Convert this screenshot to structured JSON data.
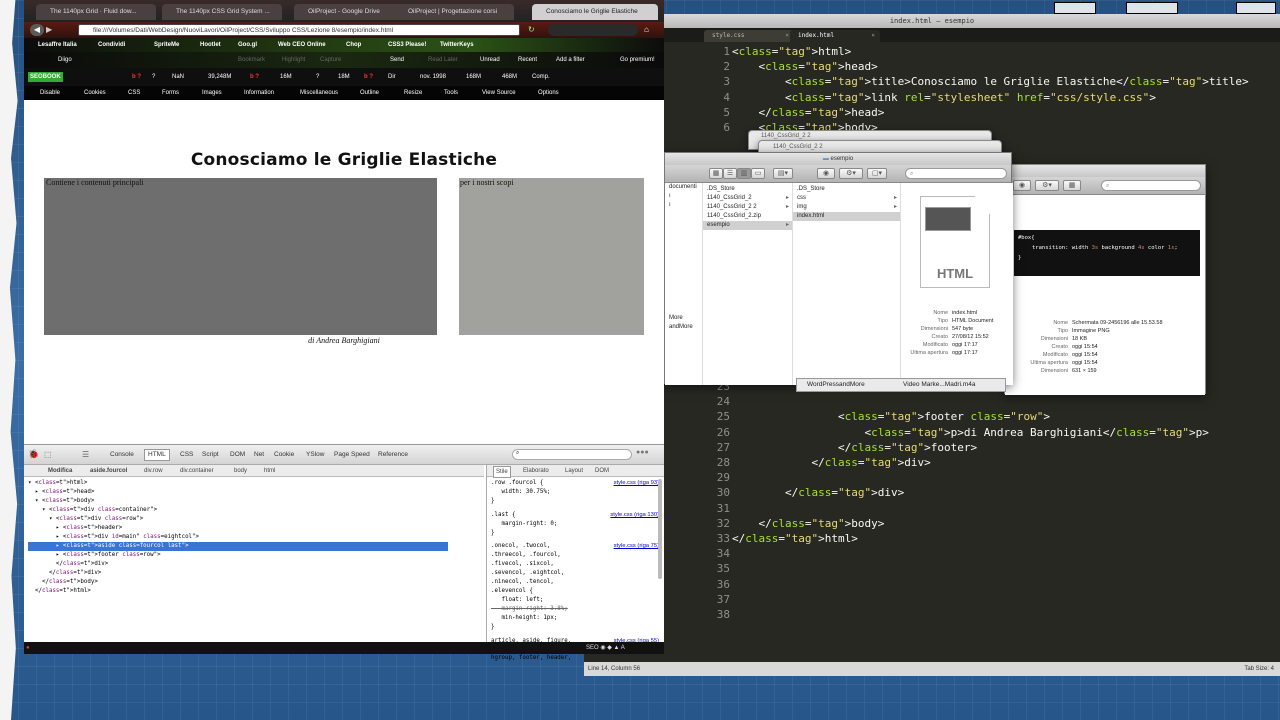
{
  "firefox": {
    "tabs": [
      "The 1140px Grid · Fluid dow...",
      "The 1140px CSS Grid System ...",
      "OilProject - Google Drive",
      "OilProject | Progettazione corsi",
      "Conosciamo le Griglie Elastiche"
    ],
    "url": "file:///Volumes/Dati/WebDesign/NuoviLavori/OilProject/CSS/Sviluppo CSS/Lezione 8/esempio/index.html",
    "bookmarks": [
      "Lesaffre Italia",
      "Condividi",
      "SpriteMe",
      "Hootlet",
      "Goo.gl",
      "Web CEO Online",
      "Chop",
      "CSS3 Please!",
      "TwitterKeys"
    ],
    "toolbar2": [
      "Diigo",
      "Bookmark",
      "Highlight",
      "Capture",
      "Send",
      "Read Later",
      "Unread",
      "Recent",
      "Add a filter",
      "Go premium!"
    ],
    "seobar": [
      "SEOBOOK",
      "b ?",
      "?",
      "NaN",
      "39,248M",
      "b ?",
      "16M",
      "?",
      "18M",
      "b ?",
      "Dir",
      "nov. 1998",
      "168M",
      "468M",
      "Comp."
    ],
    "webdev": [
      "Disable",
      "Cookies",
      "CSS",
      "Forms",
      "Images",
      "Information",
      "Miscellaneous",
      "Outline",
      "Resize",
      "Tools",
      "View Source",
      "Options"
    ],
    "page": {
      "title": "Conosciamo le Griglie Elastiche",
      "main_text": "Contiene i contenuti principali",
      "side_text": "per i nostri scopi",
      "footer": "di Andrea Barghigiani"
    }
  },
  "firebug": {
    "tabs": [
      "Console",
      "HTML",
      "CSS",
      "Script",
      "DOM",
      "Net",
      "Cookie",
      "YSlow",
      "Page Speed",
      "Reference"
    ],
    "breadcrumb": [
      "Modifica",
      "aside.fourcol",
      "div.row",
      "div.container",
      "body",
      "html"
    ],
    "side_tabs": [
      "Stile",
      "Elaborato",
      "Layout",
      "DOM"
    ],
    "tree": [
      "<html>",
      "<head>",
      "<body>",
      "<div class=\"container\">",
      "<div class=\"row\">",
      "<header>",
      "<div id=\"main\" class=\"eightcol\">",
      "<aside class=\"fourcol last\">",
      "<footer class=\"row\">",
      "</div>",
      "</div>",
      "</body>",
      "</html>"
    ],
    "css_rules": [
      {
        "selector": ".row .fourcol {",
        "decl": "width: 30.75%;",
        "source": "style.css (riga 93)"
      },
      {
        "selector": ".last {",
        "decl": "margin-right: 0;",
        "source": "style.css (riga 130)"
      },
      {
        "selector": ".onecol, .twocol,\n.threecol, .fourcol,\n.fivecol, .sixcol,\n.sevencol, .eightcol,\n.ninecol, .tencol,\n.elevencol {",
        "decl": "float: left;\nmargin-right: 3.8%;\nmin-height: 1px;",
        "source": "style.css (riga 75)"
      },
      {
        "selector": "article, aside, figure,\nfigure img, figcaption,\nhgroup, footer, header,",
        "decl": "",
        "source": "style.css (riga 55)"
      }
    ]
  },
  "editor": {
    "window_title": "index.html — esempio",
    "tabs": [
      "style.css",
      "index.html"
    ],
    "lines_top": [
      {
        "n": "1",
        "code": "<html>"
      },
      {
        "n": "2",
        "code": "    <head>"
      },
      {
        "n": "3",
        "code": "        <title>Conosciamo le Griglie Elastiche</title>"
      },
      {
        "n": "4",
        "code": "        <link rel=\"stylesheet\" href=\"css/style.css\">"
      },
      {
        "n": "5",
        "code": "    </head>"
      },
      {
        "n": "6",
        "code": "    <body>"
      }
    ],
    "lines_bottom": [
      {
        "n": "23",
        "code": ""
      },
      {
        "n": "24",
        "code": ""
      },
      {
        "n": "25",
        "code": "                <footer class=\"row\">"
      },
      {
        "n": "26",
        "code": "                    <p>di Andrea Barghigiani</p>"
      },
      {
        "n": "27",
        "code": "                </footer>"
      },
      {
        "n": "28",
        "code": "            </div>"
      },
      {
        "n": "29",
        "code": ""
      },
      {
        "n": "30",
        "code": "        </div>"
      },
      {
        "n": "31",
        "code": ""
      },
      {
        "n": "32",
        "code": "    </body>"
      },
      {
        "n": "33",
        "code": "</html>"
      },
      {
        "n": "34",
        "code": ""
      },
      {
        "n": "35",
        "code": ""
      },
      {
        "n": "36",
        "code": ""
      },
      {
        "n": "37",
        "code": ""
      },
      {
        "n": "38",
        "code": ""
      }
    ],
    "status_left": "Line 14, Column 56",
    "status_right": "Tab Size: 4"
  },
  "finder": {
    "back_titles": [
      "1140_CssGrid_2 2",
      "1140_CssGrid_2 2"
    ],
    "title": "esempio",
    "col0": [
      "documenti",
      "ı",
      "ı",
      "More",
      "andMore"
    ],
    "col1": [
      ".DS_Store",
      "1140_CssGrid_2",
      "1140_CssGrid_2 2",
      "1140_CssGrid_2.zip",
      "esempio"
    ],
    "col2": [
      ".DS_Store",
      "css",
      "img",
      "index.html"
    ],
    "icon_label": "HTML",
    "meta": [
      {
        "k": "Nome",
        "v": "index.html"
      },
      {
        "k": "Tipo",
        "v": "HTML Document"
      },
      {
        "k": "Dimensioni",
        "v": "547 byte"
      },
      {
        "k": "Creato",
        "v": "27/08/12 15:52"
      },
      {
        "k": "Modificato",
        "v": "oggi 17:17"
      },
      {
        "k": "Ultima apertura",
        "v": "oggi 17:17"
      }
    ],
    "bottom_items": [
      "WordPressandMore",
      "Video Marke...Madri.m4a"
    ],
    "search_placeholder": ""
  },
  "preview": {
    "code": "#box{",
    "transition": "transition: width 3s background 4s color 1s;",
    "close": "}",
    "meta": [
      {
        "k": "Nome",
        "v": "Schermata 09-2456196 alle 15.53.58"
      },
      {
        "k": "Tipo",
        "v": "Immagine PNG"
      },
      {
        "k": "Dimensioni",
        "v": "18 KB"
      },
      {
        "k": "Creato",
        "v": "oggi 15:54"
      },
      {
        "k": "Modificato",
        "v": "oggi 15:54"
      },
      {
        "k": "Ultima apertura",
        "v": "oggi 15:54"
      },
      {
        "k": "Dimensioni",
        "v": "631 × 159"
      }
    ]
  },
  "colors": {
    "accent": "#3875d7",
    "editor_bg": "#272822",
    "tag": "#f92672",
    "attr": "#a6e22e",
    "string": "#e6db74"
  }
}
